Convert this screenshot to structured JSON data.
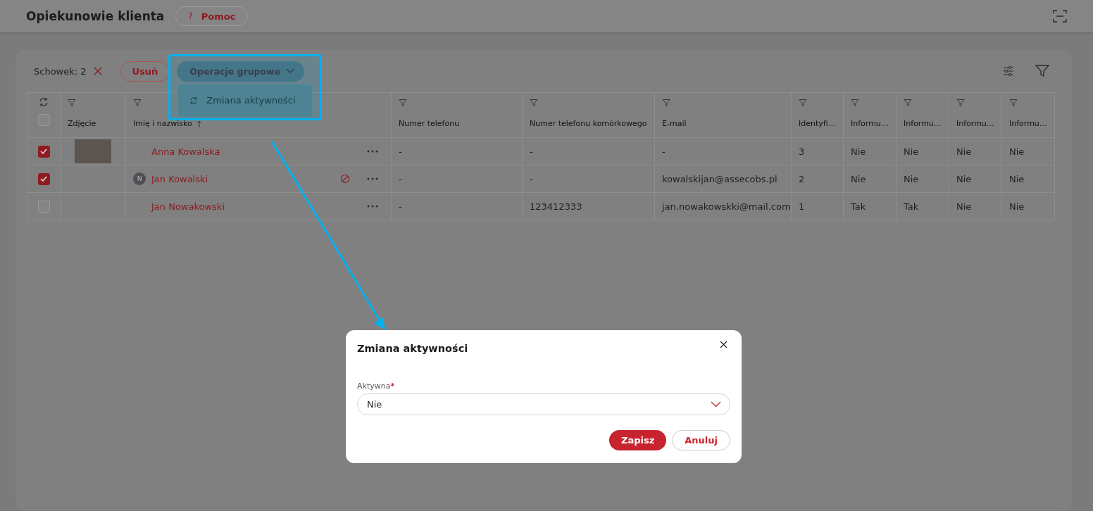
{
  "header": {
    "title": "Opiekunowie klienta",
    "help_icon": "?",
    "help_button": "Pomoc"
  },
  "toolbar": {
    "clipboard": "Schowek: 2",
    "delete_button": "Usuń",
    "group_button": "Operacje grupowe",
    "menu": [
      {
        "label": "Zmiana aktywności"
      }
    ]
  },
  "table": {
    "select_all": {
      "checked": false
    },
    "columns": [
      {
        "label": "Zdjęcie"
      },
      {
        "label": "Imię i nazwisko",
        "sorted": true
      },
      {
        "label": "Numer telefonu"
      },
      {
        "label": "Numer telefonu komórkowego"
      },
      {
        "label": "E-mail"
      },
      {
        "label": "Identyfi…"
      },
      {
        "label": "Informu…"
      },
      {
        "label": "Informu…"
      },
      {
        "label": "Informu…"
      },
      {
        "label": "Informu…"
      }
    ],
    "rows": [
      {
        "checked": true,
        "photo": true,
        "avatar": "",
        "blocked": false,
        "cells": [
          "",
          "Anna Kowalska",
          "-",
          "-",
          "-",
          "3",
          "Nie",
          "Nie",
          "Nie",
          "Nie"
        ]
      },
      {
        "checked": true,
        "photo": false,
        "avatar": "N",
        "blocked": true,
        "cells": [
          "",
          "Jan Kowalski",
          "-",
          "-",
          "kowalskijan@assecobs.pl",
          "2",
          "Nie",
          "Nie",
          "Nie",
          "Nie"
        ]
      },
      {
        "checked": false,
        "photo": false,
        "avatar": "",
        "blocked": false,
        "cells": [
          "",
          "Jan Nowakowski",
          "-",
          "123412333",
          "jan.nowakowskki@mail.com",
          "1",
          "Tak",
          "Tak",
          "Nie",
          "Nie"
        ]
      }
    ]
  },
  "modal": {
    "title": "Zmiana aktywności",
    "field_label": "Aktywna",
    "required": true,
    "required_mark": "*",
    "value": "Nie",
    "save_button": "Zapisz",
    "cancel_button": "Anuluj"
  }
}
